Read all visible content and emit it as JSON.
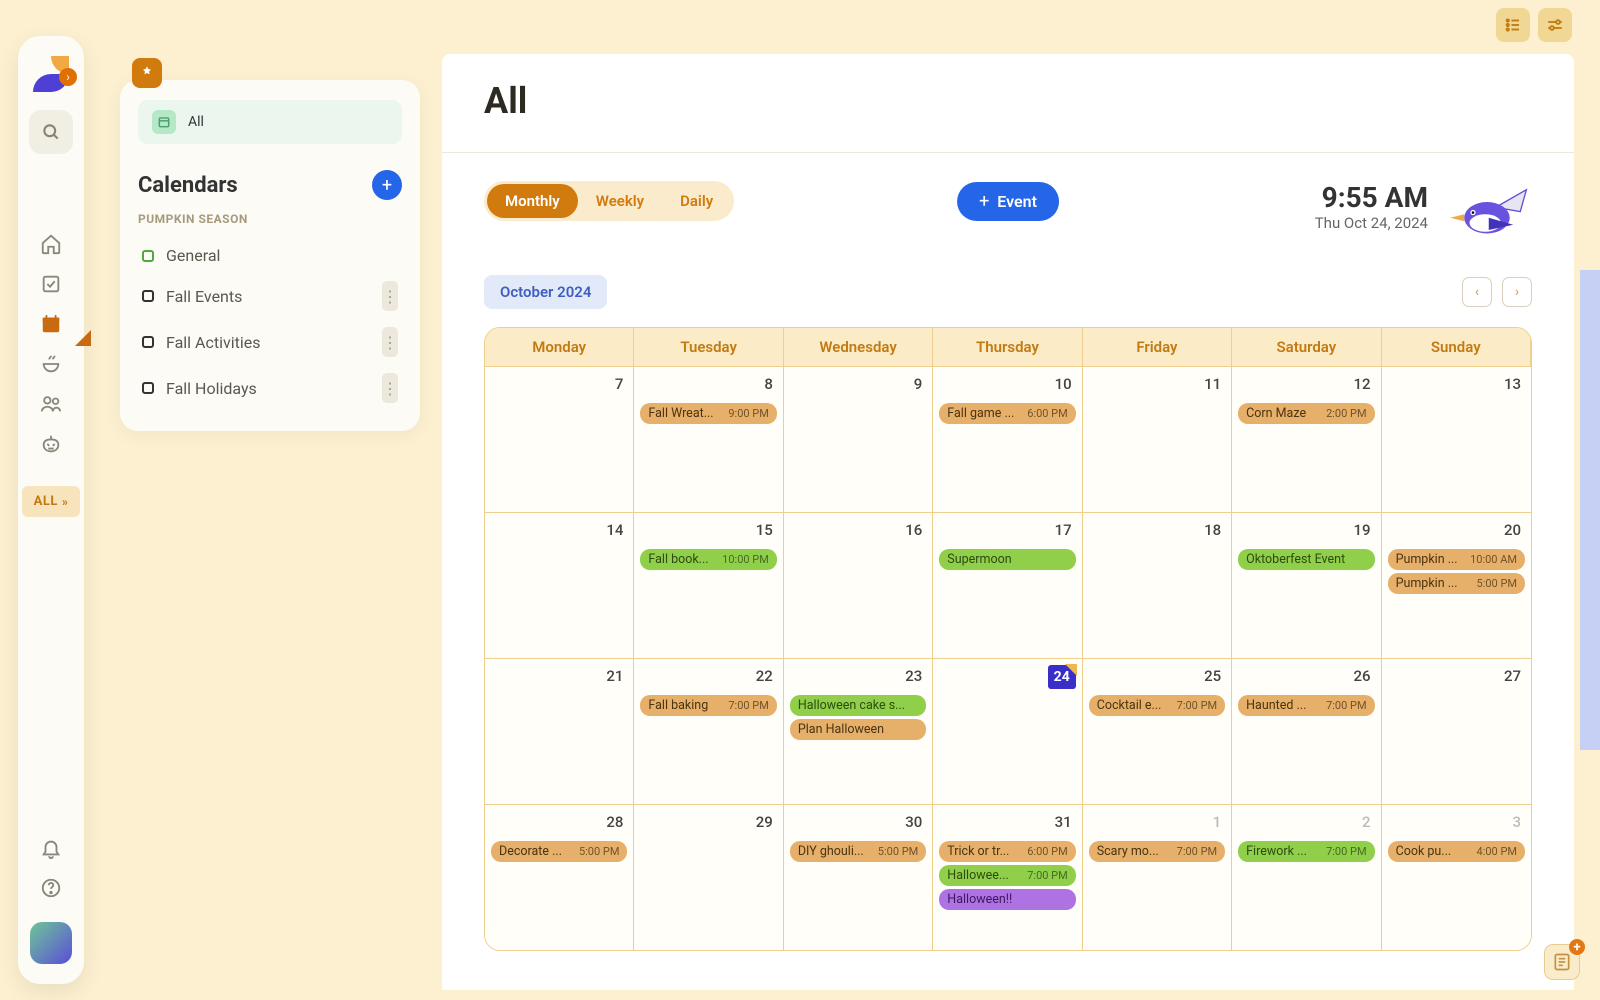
{
  "topbar": {
    "icon1": "list",
    "icon2": "sliders"
  },
  "rail": {
    "expand": "›",
    "all_label": "ALL",
    "items": [
      "home",
      "task",
      "calendar",
      "meal",
      "people",
      "pumpkin"
    ]
  },
  "panel": {
    "all_label": "All",
    "calendars_title": "Calendars",
    "season_label": "PUMPKIN SEASON",
    "items": [
      {
        "label": "General",
        "style": "general",
        "more": false
      },
      {
        "label": "Fall Events",
        "style": "",
        "more": true
      },
      {
        "label": "Fall Activities",
        "style": "",
        "more": true
      },
      {
        "label": "Fall Holidays",
        "style": "",
        "more": true
      }
    ]
  },
  "main": {
    "title": "All",
    "event_btn": "Event",
    "views": [
      "Monthly",
      "Weekly",
      "Daily"
    ],
    "time": "9:55 AM",
    "date": "Thu Oct 24, 2024",
    "month_label": "October 2024",
    "day_headers": [
      "Monday",
      "Tuesday",
      "Wednesday",
      "Thursday",
      "Friday",
      "Saturday",
      "Sunday"
    ],
    "weeks": [
      [
        {
          "n": "7"
        },
        {
          "n": "8",
          "ev": [
            {
              "c": "orange",
              "t": "Fall Wreat...",
              "time": "9:00 PM"
            }
          ]
        },
        {
          "n": "9"
        },
        {
          "n": "10",
          "ev": [
            {
              "c": "orange",
              "t": "Fall game ...",
              "time": "6:00 PM"
            }
          ]
        },
        {
          "n": "11"
        },
        {
          "n": "12",
          "ev": [
            {
              "c": "orange",
              "t": "Corn Maze",
              "time": "2:00 PM"
            }
          ]
        },
        {
          "n": "13"
        }
      ],
      [
        {
          "n": "14"
        },
        {
          "n": "15",
          "ev": [
            {
              "c": "green",
              "t": "Fall book...",
              "time": "10:00 PM"
            }
          ]
        },
        {
          "n": "16"
        },
        {
          "n": "17",
          "ev": [
            {
              "c": "green",
              "t": "Supermoon",
              "time": ""
            }
          ]
        },
        {
          "n": "18"
        },
        {
          "n": "19",
          "ev": [
            {
              "c": "green",
              "t": "Oktoberfest Event",
              "time": ""
            }
          ]
        },
        {
          "n": "20",
          "ev": [
            {
              "c": "orange",
              "t": "Pumpkin ...",
              "time": "10:00 AM"
            },
            {
              "c": "orange",
              "t": "Pumpkin ...",
              "time": "5:00 PM"
            }
          ]
        }
      ],
      [
        {
          "n": "21"
        },
        {
          "n": "22",
          "ev": [
            {
              "c": "orange",
              "t": "Fall baking",
              "time": "7:00 PM"
            }
          ]
        },
        {
          "n": "23",
          "ev": [
            {
              "c": "green",
              "t": "Halloween cake s...",
              "time": ""
            },
            {
              "c": "orange",
              "t": "Plan Halloween",
              "time": ""
            }
          ]
        },
        {
          "n": "24",
          "today": true
        },
        {
          "n": "25",
          "ev": [
            {
              "c": "orange",
              "t": "Cocktail e...",
              "time": "7:00 PM"
            }
          ]
        },
        {
          "n": "26",
          "ev": [
            {
              "c": "orange",
              "t": "Haunted ...",
              "time": "7:00 PM"
            }
          ]
        },
        {
          "n": "27"
        }
      ],
      [
        {
          "n": "28",
          "ev": [
            {
              "c": "orange",
              "t": "Decorate ...",
              "time": "5:00 PM"
            }
          ]
        },
        {
          "n": "29"
        },
        {
          "n": "30",
          "ev": [
            {
              "c": "orange",
              "t": "DIY ghouli...",
              "time": "5:00 PM"
            }
          ]
        },
        {
          "n": "31",
          "ev": [
            {
              "c": "orange",
              "t": "Trick or tr...",
              "time": "6:00 PM"
            },
            {
              "c": "green",
              "t": "Hallowee...",
              "time": "7:00 PM"
            },
            {
              "c": "purple",
              "t": "Halloween!!",
              "time": ""
            }
          ]
        },
        {
          "n": "1",
          "faded": true,
          "ev": [
            {
              "c": "orange",
              "t": "Scary mo...",
              "time": "7:00 PM"
            }
          ]
        },
        {
          "n": "2",
          "faded": true,
          "ev": [
            {
              "c": "green",
              "t": "Firework ...",
              "time": "7:00 PM"
            }
          ]
        },
        {
          "n": "3",
          "faded": true,
          "ev": [
            {
              "c": "orange",
              "t": "Cook pu...",
              "time": "4:00 PM"
            }
          ]
        }
      ]
    ]
  }
}
